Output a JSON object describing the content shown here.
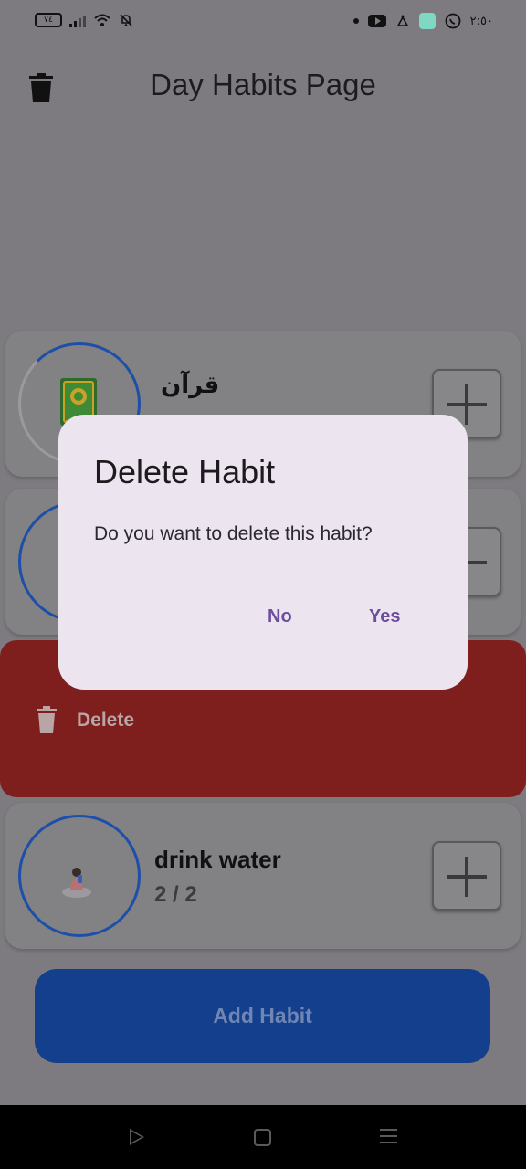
{
  "status_bar": {
    "battery": "٧٤",
    "time": "٢:٥٠"
  },
  "app_bar": {
    "title": "Day Habits Page"
  },
  "habits": [
    {
      "name": "قرآن",
      "count": ""
    },
    {
      "name": "",
      "count": ""
    },
    {
      "name": "drink water",
      "count": "2 / 2"
    }
  ],
  "swipe_action": {
    "label": "Delete"
  },
  "add_habit": {
    "label": "Add Habit"
  },
  "dialog": {
    "title": "Delete Habit",
    "message": "Do you want to delete this habit?",
    "no_label": "No",
    "yes_label": "Yes"
  },
  "colors": {
    "scrim": "#7d7b7f",
    "accent_blue": "#1e4fa8",
    "delete_red": "#7e1f1d",
    "dialog_bg": "#ece4ee",
    "dialog_button": "#6b4f9e"
  }
}
